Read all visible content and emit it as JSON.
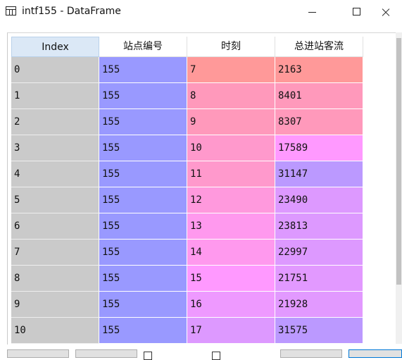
{
  "window": {
    "title": "intf155 - DataFrame"
  },
  "table": {
    "columns": [
      "Index",
      "站点编号",
      "时刻",
      "总进站客流"
    ],
    "rows": [
      {
        "index": "0",
        "station": "155",
        "hour": "7",
        "flow": "2163",
        "c_station": "#9999ff",
        "c_hour": "#ff9999",
        "c_flow": "#ff9999"
      },
      {
        "index": "1",
        "station": "155",
        "hour": "8",
        "flow": "8401",
        "c_station": "#9999ff",
        "c_hour": "#ff99bb",
        "c_flow": "#ff99bb"
      },
      {
        "index": "2",
        "station": "155",
        "hour": "9",
        "flow": "8307",
        "c_station": "#9999ff",
        "c_hour": "#ff99bb",
        "c_flow": "#ff99bb"
      },
      {
        "index": "3",
        "station": "155",
        "hour": "10",
        "flow": "17589",
        "c_station": "#9999ff",
        "c_hour": "#ff99cc",
        "c_flow": "#ff99ff"
      },
      {
        "index": "4",
        "station": "155",
        "hour": "11",
        "flow": "31147",
        "c_station": "#9999ff",
        "c_hour": "#ff99cc",
        "c_flow": "#bb99ff"
      },
      {
        "index": "5",
        "station": "155",
        "hour": "12",
        "flow": "23490",
        "c_station": "#9999ff",
        "c_hour": "#ff99dd",
        "c_flow": "#dd99ff"
      },
      {
        "index": "6",
        "station": "155",
        "hour": "13",
        "flow": "23813",
        "c_station": "#9999ff",
        "c_hour": "#ff99ee",
        "c_flow": "#dd99ff"
      },
      {
        "index": "7",
        "station": "155",
        "hour": "14",
        "flow": "22997",
        "c_station": "#9999ff",
        "c_hour": "#ff99ee",
        "c_flow": "#dd99ff"
      },
      {
        "index": "8",
        "station": "155",
        "hour": "15",
        "flow": "21751",
        "c_station": "#9999ff",
        "c_hour": "#ff99ff",
        "c_flow": "#e299ff"
      },
      {
        "index": "9",
        "station": "155",
        "hour": "16",
        "flow": "21928",
        "c_station": "#9999ff",
        "c_hour": "#ee99ff",
        "c_flow": "#e299ff"
      },
      {
        "index": "10",
        "station": "155",
        "hour": "17",
        "flow": "31575",
        "c_station": "#9999ff",
        "c_hour": "#dd99ff",
        "c_flow": "#bb99ff"
      }
    ]
  }
}
